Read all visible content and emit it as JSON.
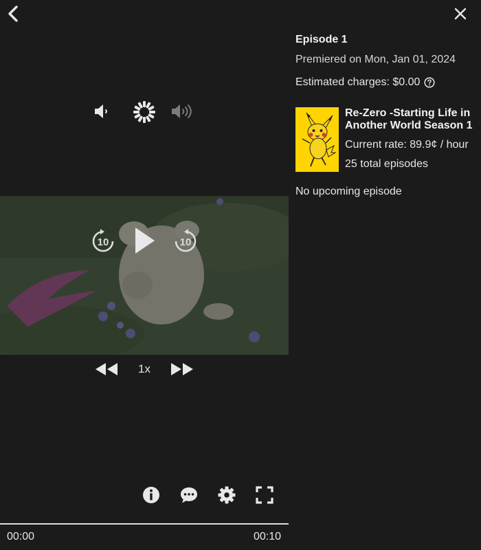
{
  "player": {
    "speed_label": "1x",
    "time_current": "00:00",
    "time_total": "00:10",
    "progress_fraction": 0.0,
    "skip_back_seconds": "10",
    "skip_forward_seconds": "10"
  },
  "panel": {
    "episode_title": "Episode 1",
    "premiere": "Premiered on Mon, Jan 01, 2024",
    "charges": "Estimated charges: $0.00",
    "show_title": "Re-Zero -Starting Life in Another World Season 1",
    "current_rate": "Current rate: 89.9¢ / hour",
    "total_episodes": "25 total episodes",
    "upcoming": "No upcoming episode"
  },
  "colors": {
    "background": "#1b1b1b",
    "text": "#e6e6e6",
    "poster_background": "#ffd400"
  },
  "icons": {
    "back": "chevron-left-icon",
    "close": "close-icon",
    "volume_down": "volume-down-icon",
    "loading": "loading-spinner-icon",
    "volume_up": "volume-up-icon",
    "rewind_10": "rewind-10-icon",
    "play": "play-icon",
    "forward_10": "forward-10-icon",
    "slower": "rewind-icon",
    "faster": "fast-forward-icon",
    "info": "info-icon",
    "chat": "chat-icon",
    "settings": "gear-icon",
    "fullscreen": "fullscreen-icon",
    "help": "help-circle-icon"
  }
}
